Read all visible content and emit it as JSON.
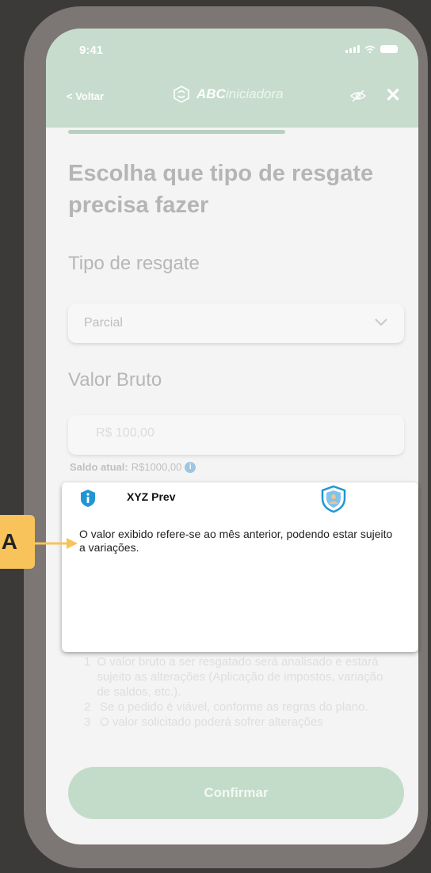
{
  "status_bar": {
    "time": "9:41"
  },
  "header": {
    "back_label": "< Voltar",
    "brand_bold": "ABC",
    "brand_light": "iniciadora",
    "close_label": "✕"
  },
  "page": {
    "title": "Escolha que tipo de resgate precisa fazer"
  },
  "form": {
    "tipo_label": "Tipo de resgate",
    "tipo_value": "Parcial",
    "valor_label": "Valor Bruto",
    "valor_placeholder": "R$ 100,00",
    "saldo_label": "Saldo atual:",
    "saldo_value": "R$1000,00"
  },
  "notes": [
    {
      "num": "1",
      "text": "O valor bruto a ser resgatado será analisado e estará sujeito as alterações (Aplicação de impostos, variação de saldos, etc.)."
    },
    {
      "num": "2",
      "text": "Se o pedido é viável, conforme as regras do plano."
    },
    {
      "num": "3",
      "text": "O valor solicitado poderá sofrer alterações"
    }
  ],
  "confirm_label": "Confirmar",
  "tooltip": {
    "title": "XYZ Prev",
    "text": "O valor exibido refere-se ao mês anterior, podendo estar sujeito a variações."
  },
  "callout": {
    "label": "A"
  },
  "colors": {
    "header_green": "#c7dccc",
    "accent_yellow": "#f7c35a",
    "info_blue": "#2196d3"
  }
}
